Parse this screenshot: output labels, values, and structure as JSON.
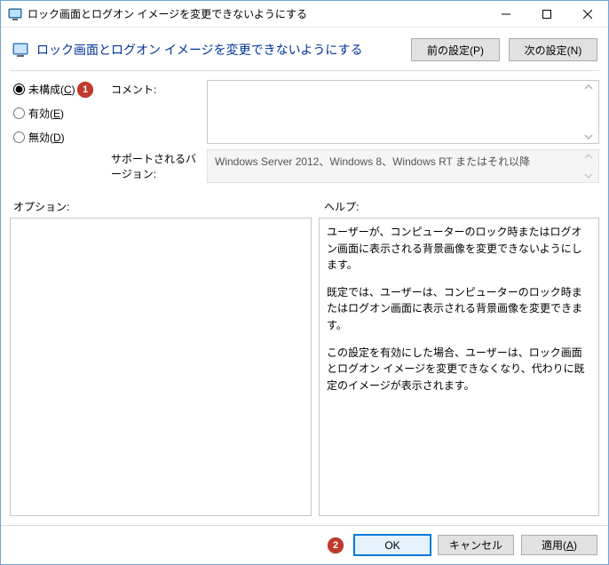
{
  "titlebar": {
    "title": "ロック画面とログオン イメージを変更できないようにする"
  },
  "header": {
    "title": "ロック画面とログオン イメージを変更できないようにする",
    "prev_label": "前の設定(P)",
    "next_label": "次の設定(N)"
  },
  "radios": {
    "not_configured": "未構成(",
    "not_configured_u": "C",
    "not_configured_end": ")",
    "enabled": "有効(",
    "enabled_u": "E",
    "enabled_end": ")",
    "disabled": "無効(",
    "disabled_u": "D",
    "disabled_end": ")"
  },
  "fields": {
    "comment_label": "コメント:",
    "supported_label": "サポートされるバージョン:",
    "supported_value": "Windows Server 2012、Windows 8、Windows RT またはそれ以降"
  },
  "sections": {
    "options": "オプション:",
    "help": "ヘルプ:"
  },
  "help": {
    "p1": "ユーザーが、コンピューターのロック時またはログオン画面に表示される背景画像を変更できないようにします。",
    "p2": "既定では、ユーザーは、コンピューターのロック時またはログオン画面に表示される背景画像を変更できます。",
    "p3": "この設定を有効にした場合、ユーザーは、ロック画面とログオン イメージを変更できなくなり、代わりに既定のイメージが表示されます。"
  },
  "footer": {
    "ok": "OK",
    "cancel": "キャンセル",
    "apply_pre": "適用(",
    "apply_u": "A",
    "apply_end": ")"
  },
  "callouts": {
    "c1": "1",
    "c2": "2"
  }
}
